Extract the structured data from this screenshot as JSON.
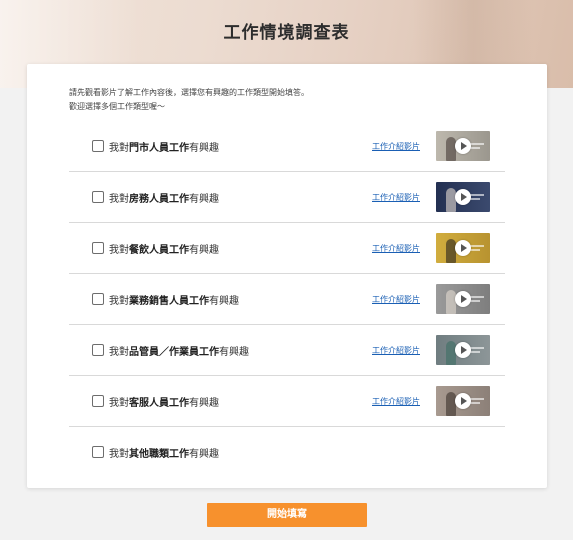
{
  "page": {
    "title": "工作情境調查表"
  },
  "intro": {
    "line1": "請先觀看影片了解工作內容後，選擇您有興趣的工作類型開始填答。",
    "line2": "歡迎選擇多個工作類型喔～"
  },
  "options": [
    {
      "prefix": "我對",
      "job": "門市人員工作",
      "suffix": "有興趣",
      "link": "工作介紹影片",
      "thumb_color": "#a8a49a",
      "checked": false
    },
    {
      "prefix": "我對",
      "job": "房務人員工作",
      "suffix": "有興趣",
      "link": "工作介紹影片",
      "thumb_color": "#2e3b5c",
      "checked": false
    },
    {
      "prefix": "我對",
      "job": "餐飲人員工作",
      "suffix": "有興趣",
      "link": "工作介紹影片",
      "thumb_color": "#c7a43a",
      "checked": false
    },
    {
      "prefix": "我對",
      "job": "業務銷售人員工作",
      "suffix": "有興趣",
      "link": "工作介紹影片",
      "thumb_color": "#8f8f8f",
      "checked": false
    },
    {
      "prefix": "我對",
      "job": "品管員／作業員工作",
      "suffix": "有興趣",
      "link": "工作介紹影片",
      "thumb_color": "#7f8a8c",
      "checked": false
    },
    {
      "prefix": "我對",
      "job": "客服人員工作",
      "suffix": "有興趣",
      "link": "工作介紹影片",
      "thumb_color": "#9a8f88",
      "checked": false
    },
    {
      "prefix": "我對",
      "job": "其他職類工作",
      "suffix": "有興趣",
      "checked": false
    }
  ],
  "actions": {
    "start_label": "開始填寫"
  },
  "colors": {
    "accent": "#f7912d",
    "link": "#1a5fb4"
  }
}
